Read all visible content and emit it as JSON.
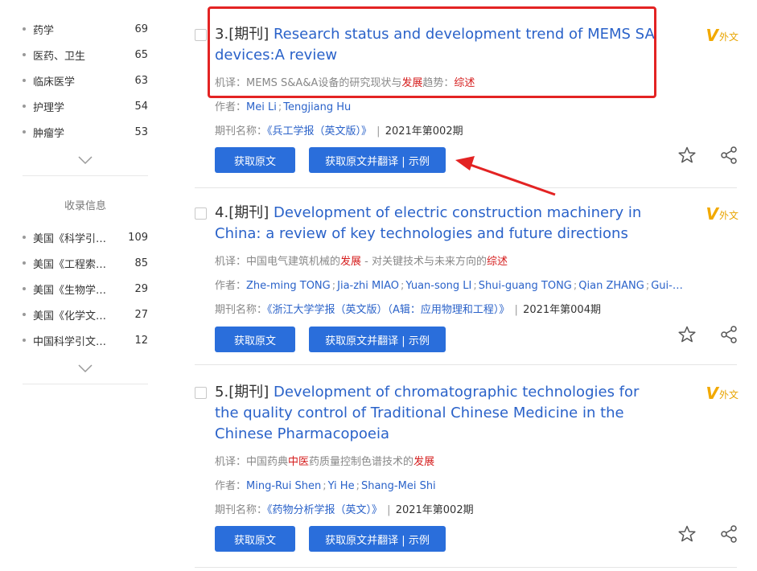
{
  "sidebar": {
    "group1": [
      {
        "label": "药学",
        "count": "69"
      },
      {
        "label": "医药、卫生",
        "count": "65"
      },
      {
        "label": "临床医学",
        "count": "63"
      },
      {
        "label": "护理学",
        "count": "54"
      },
      {
        "label": "肿瘤学",
        "count": "53"
      }
    ],
    "section_title": "收录信息",
    "group2": [
      {
        "label": "美国《科学引…",
        "count": "109"
      },
      {
        "label": "美国《工程索…",
        "count": "85"
      },
      {
        "label": "美国《生物学…",
        "count": "29"
      },
      {
        "label": "美国《化学文…",
        "count": "27"
      },
      {
        "label": "中国科学引文…",
        "count": "12"
      }
    ]
  },
  "common": {
    "author_label": "作者：",
    "journal_label": "期刊名称：",
    "mt_label": "机译：",
    "btn_get": "获取原文",
    "btn_translate": "获取原文并翻译 | 示例",
    "badge_v": "V",
    "badge_text": "外文"
  },
  "results": [
    {
      "num": "3.",
      "tag": "[期刊]",
      "title": "Research status and development trend of MEMS SA devices:A review",
      "mt_parts": [
        "MEMS S&A&A设备的研究现状与",
        "发展",
        "趋势：",
        "综述"
      ],
      "authors": [
        "Mei Li",
        "Tengjiang Hu"
      ],
      "journal": "《兵工学报（英文版）》",
      "issue": "2021年第002期"
    },
    {
      "num": "4.",
      "tag": "[期刊]",
      "title": "Development of electric construction machinery in China: a review of key technologies and future directions",
      "mt_parts": [
        "中国电气建筑机械的",
        "发展",
        " - 对关键技术与未来方向的",
        "综述"
      ],
      "authors": [
        "Zhe-ming TONG",
        "Jia-zhi MIAO",
        "Yuan-song LI",
        "Shui-guang TONG",
        "Qian ZHANG",
        "Gui-…"
      ],
      "journal": "《浙江大学学报（英文版）（A辑：应用物理和工程）》",
      "issue": "2021年第004期"
    },
    {
      "num": "5.",
      "tag": "[期刊]",
      "title": "Development of chromatographic technologies for the quality control of Traditional Chinese Medicine in the Chinese Pharmacopoeia",
      "mt_parts": [
        "中国药典",
        "中医",
        "药质量控制色谱技术的",
        "发展"
      ],
      "authors": [
        "Ming-Rui Shen",
        "Yi He",
        "Shang-Mei Shi"
      ],
      "journal": "《药物分析学报（英文）》",
      "issue": "2021年第002期"
    }
  ],
  "colors": {
    "link": "#2a62c9",
    "button": "#2a6edb",
    "highlight": "#d51c1c",
    "annotation": "#e32323",
    "badge": "#f2a900"
  },
  "icons": [
    "chevron-down-icon",
    "star-icon",
    "share-icon",
    "v-badge-icon",
    "arrow-annotation"
  ]
}
